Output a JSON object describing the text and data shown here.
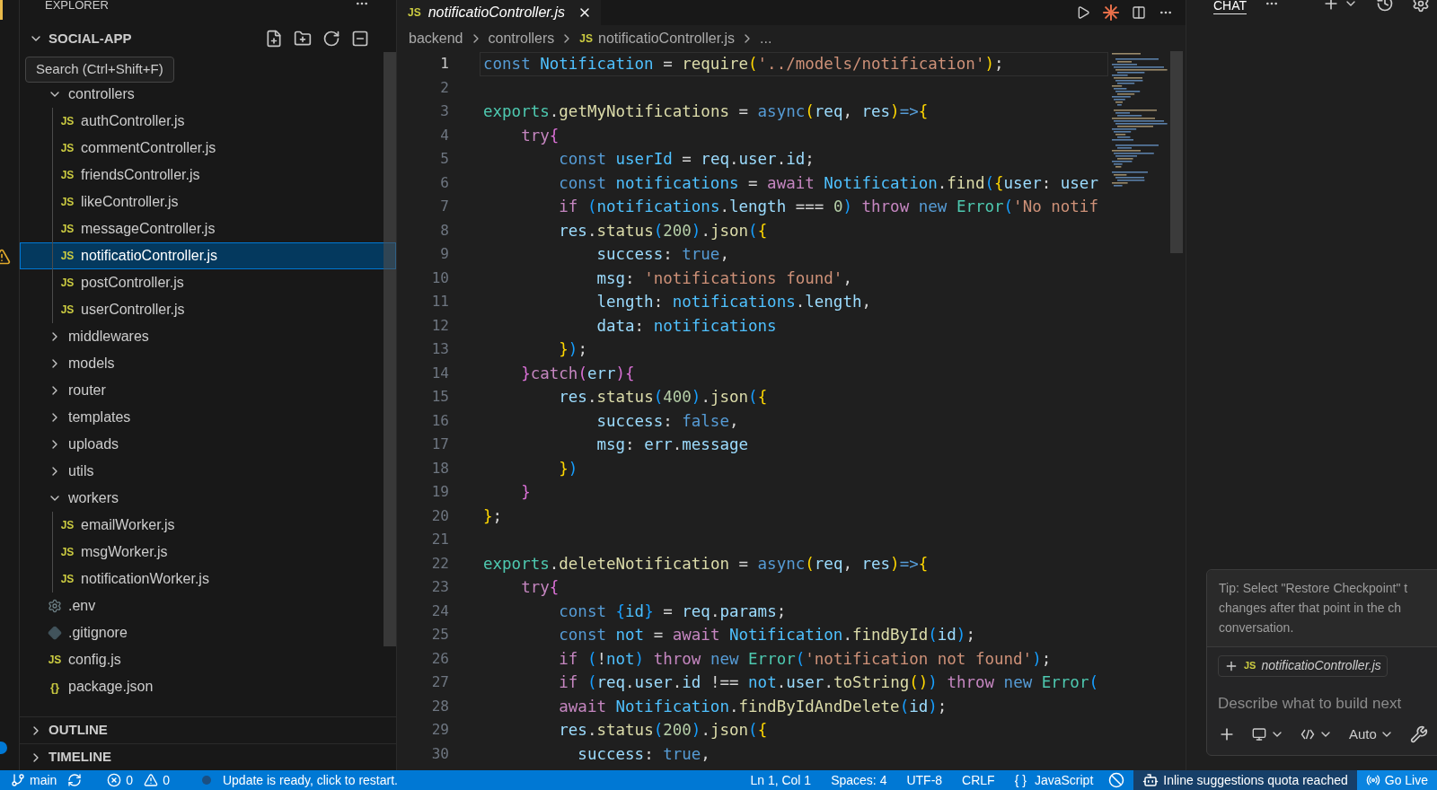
{
  "explorer": {
    "title": "EXPLORER",
    "folder": {
      "name": "SOCIAL-APP",
      "expanded": true
    },
    "tooltip": "Search (Ctrl+Shift+F)",
    "items": [
      {
        "name": "controllers",
        "kind": "folder",
        "expanded": true,
        "selected": false,
        "children": [
          {
            "name": "authController.js",
            "kind": "js",
            "badge": "JS",
            "selected": false
          },
          {
            "name": "commentController.js",
            "kind": "js",
            "badge": "JS",
            "selected": false
          },
          {
            "name": "friendsController.js",
            "kind": "js",
            "badge": "JS",
            "selected": false
          },
          {
            "name": "likeController.js",
            "kind": "js",
            "badge": "JS",
            "selected": false
          },
          {
            "name": "messageController.js",
            "kind": "js",
            "badge": "JS",
            "selected": false
          },
          {
            "name": "notificatioController.js",
            "kind": "js",
            "badge": "JS",
            "selected": true
          },
          {
            "name": "postController.js",
            "kind": "js",
            "badge": "JS",
            "selected": false
          },
          {
            "name": "userController.js",
            "kind": "js",
            "badge": "JS",
            "selected": false
          }
        ]
      },
      {
        "name": "middlewares",
        "kind": "folder",
        "expanded": false,
        "selected": false
      },
      {
        "name": "models",
        "kind": "folder",
        "expanded": false,
        "selected": false
      },
      {
        "name": "router",
        "kind": "folder",
        "expanded": false,
        "selected": false
      },
      {
        "name": "templates",
        "kind": "folder",
        "expanded": false,
        "selected": false
      },
      {
        "name": "uploads",
        "kind": "folder",
        "expanded": false,
        "selected": false
      },
      {
        "name": "utils",
        "kind": "folder",
        "expanded": false,
        "selected": false
      },
      {
        "name": "workers",
        "kind": "folder",
        "expanded": true,
        "selected": false,
        "children": [
          {
            "name": "emailWorker.js",
            "kind": "js",
            "badge": "JS",
            "selected": false
          },
          {
            "name": "msgWorker.js",
            "kind": "js",
            "badge": "JS",
            "selected": false
          },
          {
            "name": "notificationWorker.js",
            "kind": "js",
            "badge": "JS",
            "selected": false
          }
        ]
      },
      {
        "name": ".env",
        "kind": "env",
        "selected": false
      },
      {
        "name": ".gitignore",
        "kind": "git",
        "selected": false
      },
      {
        "name": "config.js",
        "kind": "js",
        "badge": "JS",
        "selected": false
      },
      {
        "name": "package.json",
        "kind": "json",
        "badge": "{}",
        "selected": false
      }
    ],
    "sections": [
      {
        "name": "OUTLINE",
        "expanded": false
      },
      {
        "name": "TIMELINE",
        "expanded": false
      }
    ]
  },
  "editor": {
    "tabs": [
      {
        "label": "notificatioController.js",
        "badge": "JS",
        "selected": true,
        "preview": true
      }
    ],
    "breadcrumb": [
      {
        "text": "backend"
      },
      {
        "text": "controllers"
      },
      {
        "text": "notificatioController.js",
        "badge": "JS"
      },
      {
        "text": "..."
      }
    ],
    "lines": [
      {
        "number": "1",
        "current": true,
        "tokens": [
          {
            "text": "const ",
            "kind": "keyword"
          },
          {
            "text": "Notification",
            "kind": "constant"
          },
          {
            "text": " = ",
            "kind": "plain"
          },
          {
            "text": "require",
            "kind": "function"
          },
          {
            "text": "(",
            "kind": "bracket1"
          },
          {
            "text": "'../models/notification'",
            "kind": "string"
          },
          {
            "text": ")",
            "kind": "bracket1"
          },
          {
            "text": ";",
            "kind": "plain"
          }
        ]
      },
      {
        "number": "2",
        "current": false
      },
      {
        "number": "3",
        "current": false,
        "tokens": [
          {
            "text": "exports",
            "kind": "class"
          },
          {
            "text": ".",
            "kind": "plain"
          },
          {
            "text": "getMyNotifications",
            "kind": "function"
          },
          {
            "text": " = ",
            "kind": "plain"
          },
          {
            "text": "async",
            "kind": "keyword"
          },
          {
            "text": "(",
            "kind": "bracket1"
          },
          {
            "text": "req",
            "kind": "variable"
          },
          {
            "text": ", ",
            "kind": "plain"
          },
          {
            "text": "res",
            "kind": "variable"
          },
          {
            "text": ")",
            "kind": "bracket1"
          },
          {
            "text": "=>",
            "kind": "keyword"
          },
          {
            "text": "{",
            "kind": "bracket1"
          }
        ]
      },
      {
        "number": "4",
        "current": false,
        "tokens": [
          {
            "text": "    try",
            "kind": "control"
          },
          {
            "text": "{",
            "kind": "bracket2"
          }
        ]
      },
      {
        "number": "5",
        "current": false,
        "tokens": [
          {
            "text": "        const ",
            "kind": "keyword"
          },
          {
            "text": "userId",
            "kind": "constant"
          },
          {
            "text": " = ",
            "kind": "plain"
          },
          {
            "text": "req",
            "kind": "variable"
          },
          {
            "text": ".",
            "kind": "plain"
          },
          {
            "text": "user",
            "kind": "variable"
          },
          {
            "text": ".",
            "kind": "plain"
          },
          {
            "text": "id",
            "kind": "variable"
          },
          {
            "text": ";",
            "kind": "plain"
          }
        ]
      },
      {
        "number": "6",
        "current": false,
        "tokens": [
          {
            "text": "        const ",
            "kind": "keyword"
          },
          {
            "text": "notifications",
            "kind": "constant"
          },
          {
            "text": " = ",
            "kind": "plain"
          },
          {
            "text": "await ",
            "kind": "control"
          },
          {
            "text": "Notification",
            "kind": "constant"
          },
          {
            "text": ".",
            "kind": "plain"
          },
          {
            "text": "find",
            "kind": "function"
          },
          {
            "text": "(",
            "kind": "bracket3"
          },
          {
            "text": "{",
            "kind": "bracket1"
          },
          {
            "text": "user",
            "kind": "variable"
          },
          {
            "text": ": ",
            "kind": "plain"
          },
          {
            "text": "user",
            "kind": "variable"
          }
        ]
      },
      {
        "number": "7",
        "current": false,
        "tokens": [
          {
            "text": "        if ",
            "kind": "control"
          },
          {
            "text": "(",
            "kind": "bracket3"
          },
          {
            "text": "notifications",
            "kind": "constant"
          },
          {
            "text": ".",
            "kind": "plain"
          },
          {
            "text": "length",
            "kind": "variable"
          },
          {
            "text": " === ",
            "kind": "plain"
          },
          {
            "text": "0",
            "kind": "number"
          },
          {
            "text": ") ",
            "kind": "bracket3"
          },
          {
            "text": "throw ",
            "kind": "control"
          },
          {
            "text": "new ",
            "kind": "keyword"
          },
          {
            "text": "Error",
            "kind": "class"
          },
          {
            "text": "(",
            "kind": "bracket3"
          },
          {
            "text": "'No notif",
            "kind": "string"
          }
        ]
      },
      {
        "number": "8",
        "current": false,
        "tokens": [
          {
            "text": "        res",
            "kind": "variable"
          },
          {
            "text": ".",
            "kind": "plain"
          },
          {
            "text": "status",
            "kind": "function"
          },
          {
            "text": "(",
            "kind": "bracket3"
          },
          {
            "text": "200",
            "kind": "number"
          },
          {
            "text": ")",
            "kind": "bracket3"
          },
          {
            "text": ".",
            "kind": "plain"
          },
          {
            "text": "json",
            "kind": "function"
          },
          {
            "text": "(",
            "kind": "bracket3"
          },
          {
            "text": "{",
            "kind": "bracket1"
          }
        ]
      },
      {
        "number": "9",
        "current": false,
        "tokens": [
          {
            "text": "            success",
            "kind": "variable"
          },
          {
            "text": ": ",
            "kind": "plain"
          },
          {
            "text": "true",
            "kind": "keyword"
          },
          {
            "text": ",",
            "kind": "plain"
          }
        ]
      },
      {
        "number": "10",
        "current": false,
        "tokens": [
          {
            "text": "            msg",
            "kind": "variable"
          },
          {
            "text": ": ",
            "kind": "plain"
          },
          {
            "text": "'notifications found'",
            "kind": "string"
          },
          {
            "text": ",",
            "kind": "plain"
          }
        ]
      },
      {
        "number": "11",
        "current": false,
        "tokens": [
          {
            "text": "            length",
            "kind": "variable"
          },
          {
            "text": ": ",
            "kind": "plain"
          },
          {
            "text": "notifications",
            "kind": "constant"
          },
          {
            "text": ".",
            "kind": "plain"
          },
          {
            "text": "length",
            "kind": "variable"
          },
          {
            "text": ",",
            "kind": "plain"
          }
        ]
      },
      {
        "number": "12",
        "current": false,
        "tokens": [
          {
            "text": "            data",
            "kind": "variable"
          },
          {
            "text": ": ",
            "kind": "plain"
          },
          {
            "text": "notifications",
            "kind": "constant"
          }
        ]
      },
      {
        "number": "13",
        "current": false,
        "tokens": [
          {
            "text": "        }",
            "kind": "bracket1"
          },
          {
            "text": ")",
            "kind": "bracket3"
          },
          {
            "text": ";",
            "kind": "plain"
          }
        ]
      },
      {
        "number": "14",
        "current": false,
        "tokens": [
          {
            "text": "    }",
            "kind": "bracket2"
          },
          {
            "text": "catch",
            "kind": "control"
          },
          {
            "text": "(",
            "kind": "bracket2"
          },
          {
            "text": "err",
            "kind": "variable"
          },
          {
            "text": ")",
            "kind": "bracket2"
          },
          {
            "text": "{",
            "kind": "bracket2"
          }
        ]
      },
      {
        "number": "15",
        "current": false,
        "tokens": [
          {
            "text": "        res",
            "kind": "variable"
          },
          {
            "text": ".",
            "kind": "plain"
          },
          {
            "text": "status",
            "kind": "function"
          },
          {
            "text": "(",
            "kind": "bracket3"
          },
          {
            "text": "400",
            "kind": "number"
          },
          {
            "text": ")",
            "kind": "bracket3"
          },
          {
            "text": ".",
            "kind": "plain"
          },
          {
            "text": "json",
            "kind": "function"
          },
          {
            "text": "(",
            "kind": "bracket3"
          },
          {
            "text": "{",
            "kind": "bracket1"
          }
        ]
      },
      {
        "number": "16",
        "current": false,
        "tokens": [
          {
            "text": "            success",
            "kind": "variable"
          },
          {
            "text": ": ",
            "kind": "plain"
          },
          {
            "text": "false",
            "kind": "keyword"
          },
          {
            "text": ",",
            "kind": "plain"
          }
        ]
      },
      {
        "number": "17",
        "current": false,
        "tokens": [
          {
            "text": "            msg",
            "kind": "variable"
          },
          {
            "text": ": ",
            "kind": "plain"
          },
          {
            "text": "err",
            "kind": "variable"
          },
          {
            "text": ".",
            "kind": "plain"
          },
          {
            "text": "message",
            "kind": "variable"
          }
        ]
      },
      {
        "number": "18",
        "current": false,
        "tokens": [
          {
            "text": "        }",
            "kind": "bracket1"
          },
          {
            "text": ")",
            "kind": "bracket3"
          }
        ]
      },
      {
        "number": "19",
        "current": false,
        "tokens": [
          {
            "text": "    }",
            "kind": "bracket2"
          }
        ]
      },
      {
        "number": "20",
        "current": false,
        "tokens": [
          {
            "text": "}",
            "kind": "bracket1"
          },
          {
            "text": ";",
            "kind": "plain"
          }
        ]
      },
      {
        "number": "21",
        "current": false
      },
      {
        "number": "22",
        "current": false,
        "tokens": [
          {
            "text": "exports",
            "kind": "class"
          },
          {
            "text": ".",
            "kind": "plain"
          },
          {
            "text": "deleteNotification",
            "kind": "function"
          },
          {
            "text": " = ",
            "kind": "plain"
          },
          {
            "text": "async",
            "kind": "keyword"
          },
          {
            "text": "(",
            "kind": "bracket1"
          },
          {
            "text": "req",
            "kind": "variable"
          },
          {
            "text": ", ",
            "kind": "plain"
          },
          {
            "text": "res",
            "kind": "variable"
          },
          {
            "text": ")",
            "kind": "bracket1"
          },
          {
            "text": "=>",
            "kind": "keyword"
          },
          {
            "text": "{",
            "kind": "bracket1"
          }
        ]
      },
      {
        "number": "23",
        "current": false,
        "tokens": [
          {
            "text": "    try",
            "kind": "control"
          },
          {
            "text": "{",
            "kind": "bracket2"
          }
        ]
      },
      {
        "number": "24",
        "current": false,
        "tokens": [
          {
            "text": "        const ",
            "kind": "keyword"
          },
          {
            "text": "{",
            "kind": "bracket3"
          },
          {
            "text": "id",
            "kind": "constant"
          },
          {
            "text": "}",
            "kind": "bracket3"
          },
          {
            "text": " = ",
            "kind": "plain"
          },
          {
            "text": "req",
            "kind": "variable"
          },
          {
            "text": ".",
            "kind": "plain"
          },
          {
            "text": "params",
            "kind": "variable"
          },
          {
            "text": ";",
            "kind": "plain"
          }
        ]
      },
      {
        "number": "25",
        "current": false,
        "tokens": [
          {
            "text": "        const ",
            "kind": "keyword"
          },
          {
            "text": "not",
            "kind": "constant"
          },
          {
            "text": " = ",
            "kind": "plain"
          },
          {
            "text": "await ",
            "kind": "control"
          },
          {
            "text": "Notification",
            "kind": "constant"
          },
          {
            "text": ".",
            "kind": "plain"
          },
          {
            "text": "findById",
            "kind": "function"
          },
          {
            "text": "(",
            "kind": "bracket3"
          },
          {
            "text": "id",
            "kind": "variable"
          },
          {
            "text": ")",
            "kind": "bracket3"
          },
          {
            "text": ";",
            "kind": "plain"
          }
        ]
      },
      {
        "number": "26",
        "current": false,
        "tokens": [
          {
            "text": "        if ",
            "kind": "control"
          },
          {
            "text": "(",
            "kind": "bracket3"
          },
          {
            "text": "!",
            "kind": "plain"
          },
          {
            "text": "not",
            "kind": "constant"
          },
          {
            "text": ") ",
            "kind": "bracket3"
          },
          {
            "text": "throw ",
            "kind": "control"
          },
          {
            "text": "new ",
            "kind": "keyword"
          },
          {
            "text": "Error",
            "kind": "class"
          },
          {
            "text": "(",
            "kind": "bracket3"
          },
          {
            "text": "'notification not found'",
            "kind": "string"
          },
          {
            "text": ")",
            "kind": "bracket3"
          },
          {
            "text": ";",
            "kind": "plain"
          }
        ]
      },
      {
        "number": "27",
        "current": false,
        "tokens": [
          {
            "text": "        if ",
            "kind": "control"
          },
          {
            "text": "(",
            "kind": "bracket3"
          },
          {
            "text": "req",
            "kind": "variable"
          },
          {
            "text": ".",
            "kind": "plain"
          },
          {
            "text": "user",
            "kind": "variable"
          },
          {
            "text": ".",
            "kind": "plain"
          },
          {
            "text": "id",
            "kind": "variable"
          },
          {
            "text": " !== ",
            "kind": "plain"
          },
          {
            "text": "not",
            "kind": "constant"
          },
          {
            "text": ".",
            "kind": "plain"
          },
          {
            "text": "user",
            "kind": "variable"
          },
          {
            "text": ".",
            "kind": "plain"
          },
          {
            "text": "toString",
            "kind": "function"
          },
          {
            "text": "()",
            "kind": "bracket1"
          },
          {
            "text": ") ",
            "kind": "bracket3"
          },
          {
            "text": "throw ",
            "kind": "control"
          },
          {
            "text": "new ",
            "kind": "keyword"
          },
          {
            "text": "Error",
            "kind": "class"
          },
          {
            "text": "(",
            "kind": "bracket3"
          }
        ]
      },
      {
        "number": "28",
        "current": false,
        "tokens": [
          {
            "text": "        await ",
            "kind": "control"
          },
          {
            "text": "Notification",
            "kind": "constant"
          },
          {
            "text": ".",
            "kind": "plain"
          },
          {
            "text": "findByIdAndDelete",
            "kind": "function"
          },
          {
            "text": "(",
            "kind": "bracket3"
          },
          {
            "text": "id",
            "kind": "variable"
          },
          {
            "text": ")",
            "kind": "bracket3"
          },
          {
            "text": ";",
            "kind": "plain"
          }
        ]
      },
      {
        "number": "29",
        "current": false,
        "tokens": [
          {
            "text": "        res",
            "kind": "variable"
          },
          {
            "text": ".",
            "kind": "plain"
          },
          {
            "text": "status",
            "kind": "function"
          },
          {
            "text": "(",
            "kind": "bracket3"
          },
          {
            "text": "200",
            "kind": "number"
          },
          {
            "text": ")",
            "kind": "bracket3"
          },
          {
            "text": ".",
            "kind": "plain"
          },
          {
            "text": "json",
            "kind": "function"
          },
          {
            "text": "(",
            "kind": "bracket3"
          },
          {
            "text": "{",
            "kind": "bracket1"
          }
        ]
      },
      {
        "number": "30",
        "current": false,
        "tokens": [
          {
            "text": "          success",
            "kind": "variable"
          },
          {
            "text": ": ",
            "kind": "plain"
          },
          {
            "text": "true",
            "kind": "keyword"
          },
          {
            "text": ",",
            "kind": "plain"
          }
        ]
      }
    ]
  },
  "chat": {
    "tab": {
      "label": "CHAT",
      "selected": true
    },
    "tip_lines": [
      "Tip: Select \"Restore Checkpoint\" t",
      "changes after that point in the ch",
      "conversation."
    ],
    "attachment": {
      "badge": "JS",
      "name": "notificatioController.js"
    },
    "input": {
      "placeholder": "Describe what to build next"
    },
    "mode": "Auto"
  },
  "status_bar": {
    "left": [
      {
        "kind": "branch",
        "text": "main"
      },
      {
        "kind": "sync"
      },
      {
        "kind": "errors",
        "text": "0"
      },
      {
        "kind": "warnings",
        "text": "0"
      },
      {
        "kind": "update",
        "text": "Update is ready, click to restart."
      }
    ],
    "right": [
      {
        "kind": "plain",
        "text": "Ln 1, Col 1"
      },
      {
        "kind": "plain",
        "text": "Spaces: 4"
      },
      {
        "kind": "plain",
        "text": "UTF-8"
      },
      {
        "kind": "plain",
        "text": "CRLF"
      },
      {
        "kind": "language",
        "prefix": "{ }",
        "text": "JavaScript"
      },
      {
        "kind": "blocked"
      },
      {
        "kind": "quota",
        "text": "Inline suggestions quota reached"
      },
      {
        "kind": "live",
        "text": "Go Live"
      }
    ]
  }
}
